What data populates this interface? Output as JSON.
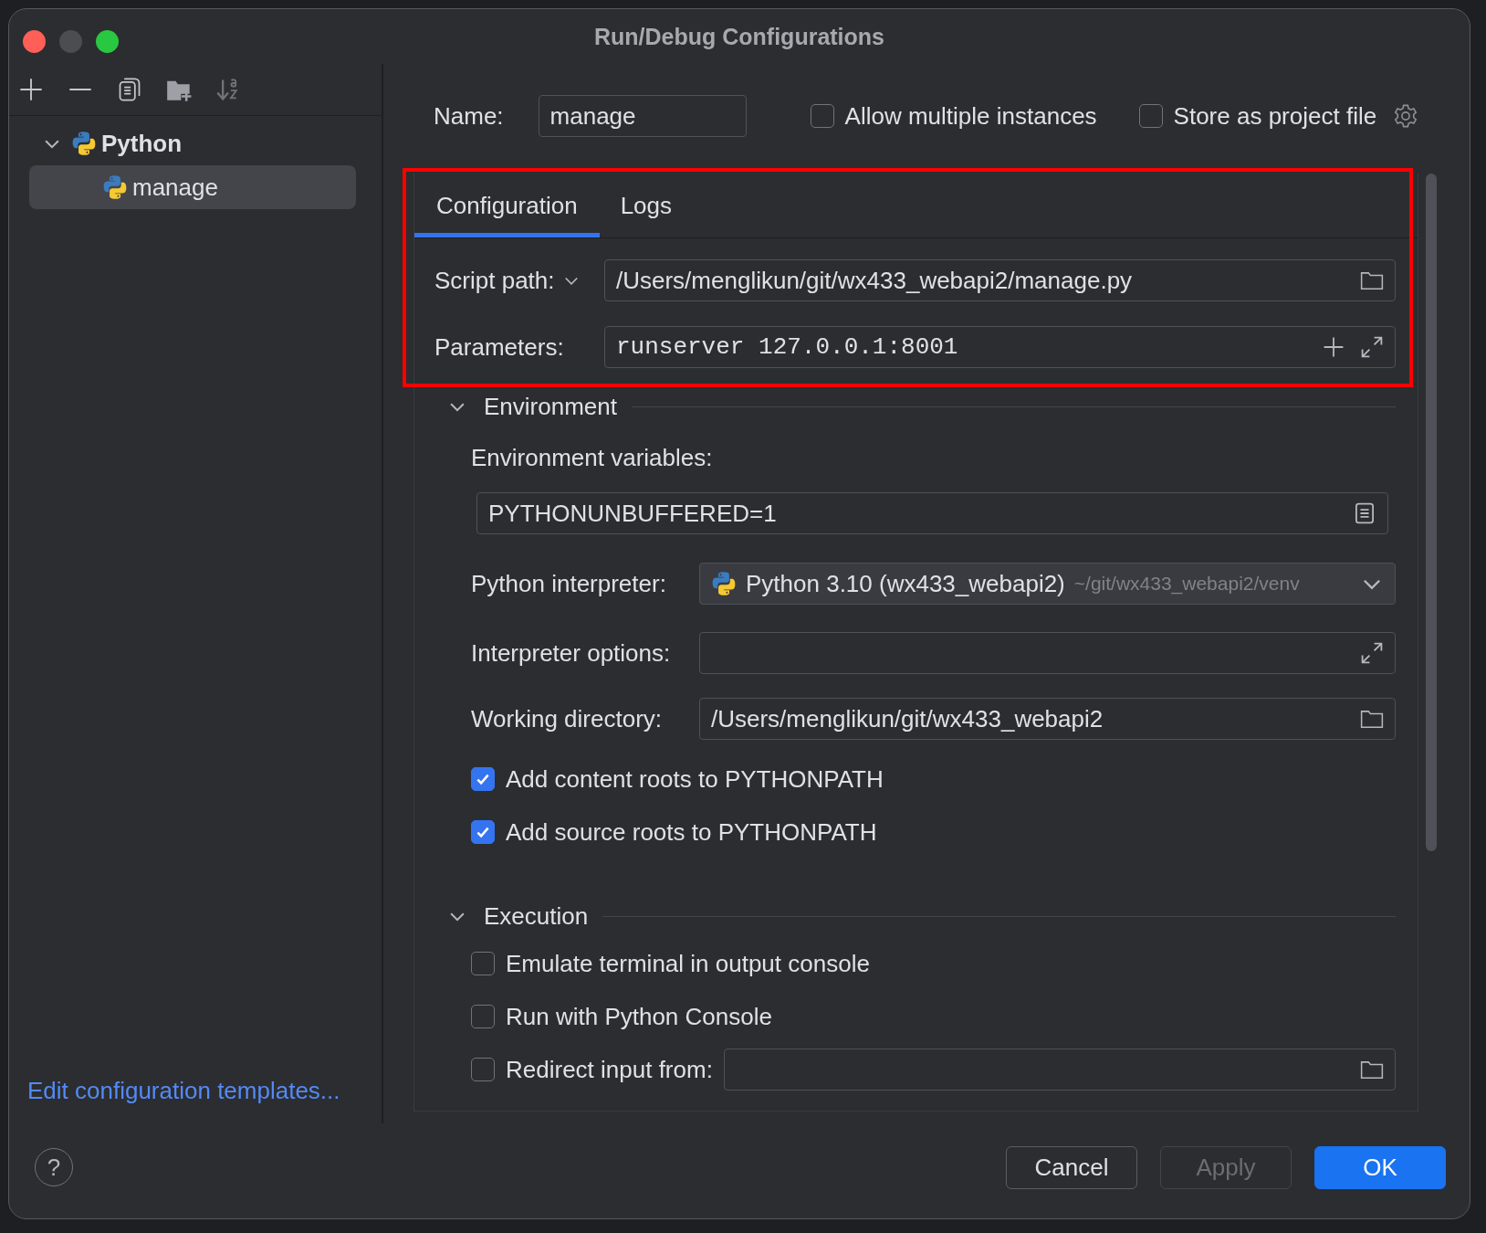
{
  "window": {
    "title": "Run/Debug Configurations"
  },
  "sidebar": {
    "tree": [
      {
        "label": "Python",
        "expanded": true,
        "selected": false,
        "children": [
          {
            "label": "manage",
            "selected": true
          }
        ]
      }
    ],
    "footer_link": "Edit configuration templates..."
  },
  "name": {
    "label": "Name:",
    "value": "manage"
  },
  "options": [
    {
      "label": "Allow multiple instances",
      "checked": false
    },
    {
      "label": "Store as project file",
      "checked": false
    }
  ],
  "tabs": [
    {
      "label": "Configuration",
      "selected": true
    },
    {
      "label": "Logs",
      "selected": false
    }
  ],
  "main_fields": [
    {
      "kind": "path",
      "label": "Script path:",
      "has_menu": true,
      "value": "/Users/menglikun/git/wx433_webapi2/manage.py"
    },
    {
      "kind": "params",
      "label": "Parameters:",
      "has_menu": false,
      "value": "runserver 127.0.0.1:8001"
    }
  ],
  "environment": {
    "title": "Environment",
    "expanded": true,
    "env_label": "Environment variables:",
    "env_value": "PYTHONUNBUFFERED=1",
    "fields": [
      {
        "kind": "interpreter",
        "label": "Python interpreter:",
        "value": "Python 3.10 (wx433_webapi2)",
        "hint": "~/git/wx433_webapi2/venv"
      },
      {
        "kind": "expand",
        "label": "Interpreter options:"
      },
      {
        "kind": "path",
        "label": "Working directory:",
        "value": "/Users/menglikun/git/wx433_webapi2"
      }
    ],
    "checkboxes": [
      {
        "label": "Add content roots to PYTHONPATH",
        "checked": true
      },
      {
        "label": "Add source roots to PYTHONPATH",
        "checked": true
      }
    ]
  },
  "execution": {
    "title": "Execution",
    "expanded": true,
    "items": [
      {
        "kind": "checkbox",
        "label": "Emulate terminal in output console",
        "checked": false
      },
      {
        "kind": "checkbox",
        "label": "Run with Python Console",
        "checked": false
      },
      {
        "kind": "checkbox-path",
        "label": "Redirect input from:",
        "checked": false
      }
    ]
  },
  "help": {
    "label": "?"
  },
  "buttons": [
    {
      "label": "Cancel",
      "kind": "secondary",
      "disabled": false
    },
    {
      "label": "Apply",
      "kind": "secondary",
      "disabled": true
    },
    {
      "label": "OK",
      "kind": "primary",
      "disabled": false
    }
  ]
}
